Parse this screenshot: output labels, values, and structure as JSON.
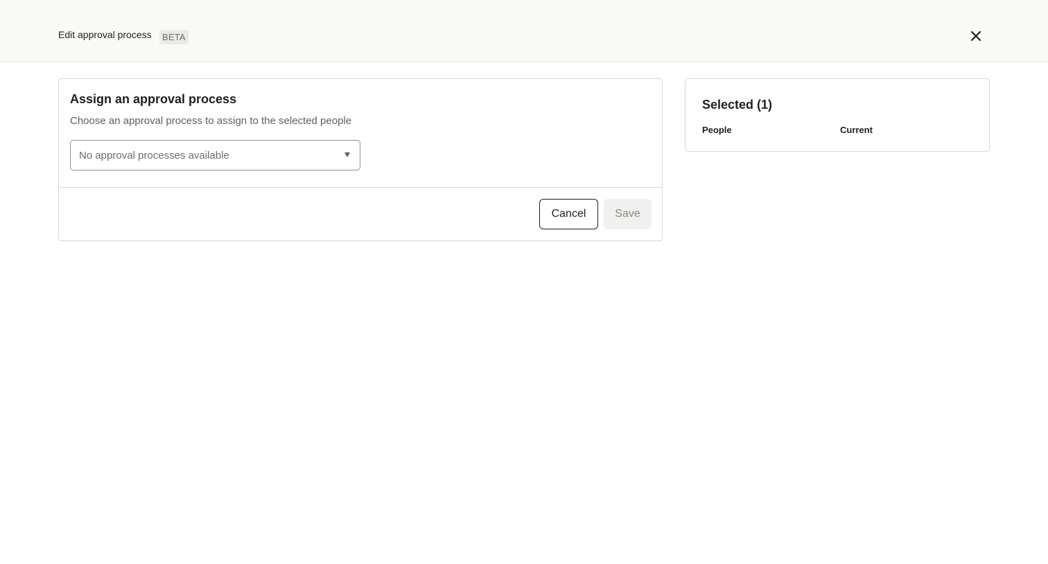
{
  "header": {
    "title": "Edit approval process",
    "badge": "BETA",
    "close_icon": "close-icon"
  },
  "assign_card": {
    "title": "Assign an approval process",
    "description": "Choose an approval process to assign to the selected people",
    "select": {
      "value": "No approval processes available",
      "caret_icon": "caret-down-icon"
    },
    "cancel_label": "Cancel",
    "save_label": "Save"
  },
  "selected_card": {
    "title": "Selected (1)",
    "columns": [
      "People",
      "Current"
    ]
  },
  "colors": {
    "header_bg": "#f9f9f6",
    "badge_bg": "#ebeae4",
    "border": "#d8d8d4",
    "text": "#1f1f1f",
    "muted_text": "#5f5f5a",
    "disabled_button_bg": "#f0f0ee"
  }
}
